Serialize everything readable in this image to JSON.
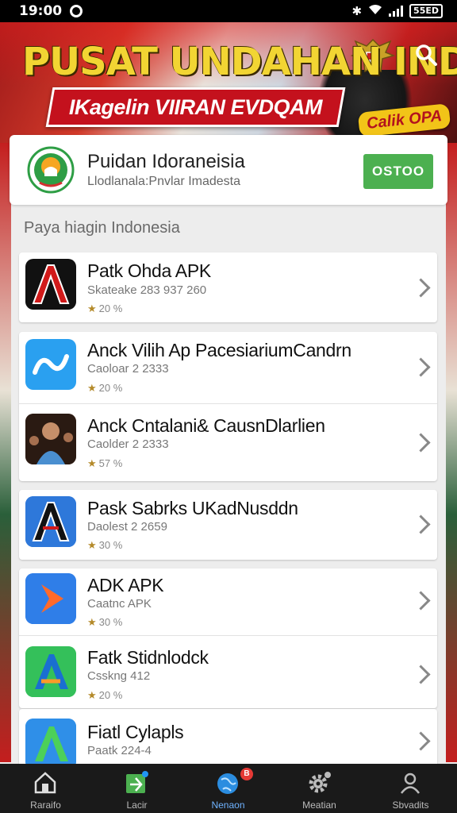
{
  "status_bar": {
    "time": "19:00",
    "battery": "55ED"
  },
  "banner": {
    "headline": "PUSAT UNDAHAN INDA",
    "ribbon_text": "IKagelin VIIRAN EVDQAM",
    "badge": "Calik OPA"
  },
  "featured": {
    "name": "Puidan Idoraneisia",
    "subtitle": "Llodlanala:Pnvlar Imadesta",
    "button_label": "OSTOO"
  },
  "section_title": "Paya hiagin Indonesia",
  "apps": [
    {
      "title": "Patk Ohda APK",
      "meta": "Skateake 283 937 260",
      "rating": "20 %"
    },
    {
      "title": "Anck Vilih Ap PacesiariumCandrn",
      "meta": "Caoloar 2 2333",
      "rating": "20 %"
    },
    {
      "title": "Anck Cntalani& CausnDlarlien",
      "meta": "Caolder 2 2333",
      "rating": "57 %"
    },
    {
      "title": "Pask Sabrks UKadNusddn",
      "meta": "Daolest 2 2659",
      "rating": "30 %"
    },
    {
      "title": "ADK APK",
      "meta": "Caatnc APK",
      "rating": "30 %"
    },
    {
      "title": "Fatk Stidnlodck",
      "meta": "Csskng 412",
      "rating": "20 %"
    },
    {
      "title": "Fiatl Cylapls",
      "meta": "Paatk 224-4",
      "rating": ""
    }
  ],
  "bottom_nav": [
    {
      "label": "Raraifo",
      "icon": "home-icon"
    },
    {
      "label": "Lacir",
      "icon": "download-icon"
    },
    {
      "label": "Nenaon",
      "icon": "globe-icon",
      "badge": "B"
    },
    {
      "label": "Meatian",
      "icon": "settings-icon"
    },
    {
      "label": "Sbvadits",
      "icon": "profile-icon"
    }
  ],
  "colors": {
    "install_button": "#4cb050",
    "active_nav": "#6fb3ff",
    "banner_red": "#c4111d",
    "banner_yellow": "#f2d533"
  }
}
